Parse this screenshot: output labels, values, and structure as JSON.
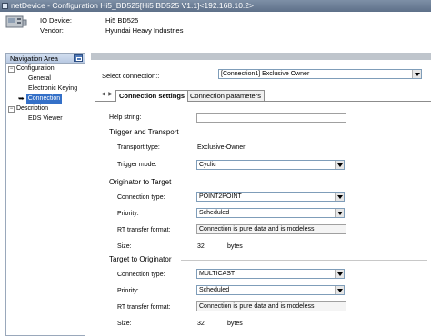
{
  "window": {
    "title": "netDevice - Configuration Hi5_BD525[Hi5 BD525 V1.1]<192.168.10.2>"
  },
  "device": {
    "io_device_label": "IO Device:",
    "io_device_value": "Hi5 BD525",
    "vendor_label": "Vendor:",
    "vendor_value": "Hyundai Heavy Industries"
  },
  "nav": {
    "title": "Navigation Area",
    "tree": [
      {
        "label": "Configuration",
        "level": 0,
        "expander": "−"
      },
      {
        "label": "General",
        "level": 1
      },
      {
        "label": "Electronic Keying",
        "level": 1
      },
      {
        "label": "Connection",
        "level": 1,
        "selected": true
      },
      {
        "label": "Description",
        "level": 0,
        "expander": "−"
      },
      {
        "label": "EDS Viewer",
        "level": 1
      }
    ]
  },
  "connection": {
    "select_label": "Select connection::",
    "selected": "[Connection1] Exclusive Owner"
  },
  "tabs": [
    {
      "label": "Connection settings",
      "active": true
    },
    {
      "label": "Connection parameters",
      "active": false
    }
  ],
  "settings": {
    "help_string_label": "Help string:",
    "help_string_value": "",
    "trigger_section": "Trigger and Transport",
    "transport_type_label": "Transport type:",
    "transport_type_value": "Exclusive-Owner",
    "trigger_mode_label": "Trigger mode:",
    "trigger_mode_value": "Cyclic",
    "o2t_section": "Originator to Target",
    "o2t_connection_type_label": "Connection type:",
    "o2t_connection_type_value": "POINT2POINT",
    "o2t_priority_label": "Priority:",
    "o2t_priority_value": "Scheduled",
    "o2t_rt_label": "RT transfer format:",
    "o2t_rt_value": "Connection is pure data and is modeless",
    "o2t_size_label": "Size:",
    "o2t_size_value": "32",
    "o2t_size_unit": "bytes",
    "t2o_section": "Target to Originator",
    "t2o_connection_type_label": "Connection type:",
    "t2o_connection_type_value": "MULTICAST",
    "t2o_priority_label": "Priority:",
    "t2o_priority_value": "Scheduled",
    "t2o_rt_label": "RT transfer format:",
    "t2o_rt_value": "Connection is pure data and is modeless",
    "t2o_size_label": "Size:",
    "t2o_size_value": "32",
    "t2o_size_unit": "bytes"
  },
  "colors": {
    "selection": "#3470c8",
    "title_bar": "#5e7089"
  },
  "icons": [
    "app-icon",
    "device-icon",
    "collapse-icon",
    "arrow-icon",
    "dropdown-arrow-icon",
    "tab-scroll-left-icon",
    "tab-scroll-right-icon"
  ]
}
